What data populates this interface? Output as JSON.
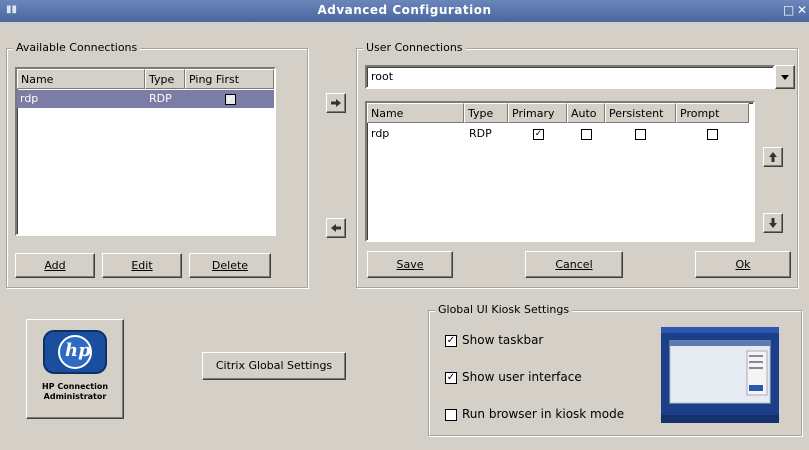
{
  "window": {
    "title": "Advanced Configuration",
    "colors": {
      "titlebar": "#4a679f",
      "selection": "#7b7da6",
      "face": "#d4d0c8",
      "logo_blue": "#1a4f9e"
    }
  },
  "available": {
    "legend": "Available Connections",
    "columns": [
      "Name",
      "Type",
      "Ping First"
    ],
    "rows": [
      {
        "name": "rdp",
        "type": "RDP",
        "ping_first": true
      }
    ],
    "buttons": {
      "add": "Add",
      "edit": "Edit",
      "delete": "Delete"
    }
  },
  "user": {
    "legend": "User Connections",
    "user_select_value": "root",
    "columns": [
      "Name",
      "Type",
      "Primary",
      "Auto",
      "Persistent",
      "Prompt"
    ],
    "rows": [
      {
        "name": "rdp",
        "type": "RDP",
        "primary": true,
        "auto": false,
        "persistent": false,
        "prompt": false
      }
    ],
    "buttons": {
      "save": "Save",
      "cancel": "Cancel",
      "ok": "Ok"
    }
  },
  "logo": {
    "brand": "hp",
    "caption_line1": "HP Connection",
    "caption_line2": "Administrator"
  },
  "citrix_button": "Citrix Global Settings",
  "kiosk": {
    "legend": "Global UI Kiosk Settings",
    "options": [
      {
        "label": "Show taskbar",
        "checked": true
      },
      {
        "label": "Show user interface",
        "checked": true
      },
      {
        "label": "Run browser in kiosk mode",
        "checked": false
      }
    ]
  },
  "icons": [
    "window-menu-icon",
    "maximize-icon",
    "close-icon",
    "arrow-right-icon",
    "arrow-left-icon",
    "arrow-up-icon",
    "arrow-down-icon",
    "dropdown-arrow-icon",
    "hp-logo-icon"
  ]
}
